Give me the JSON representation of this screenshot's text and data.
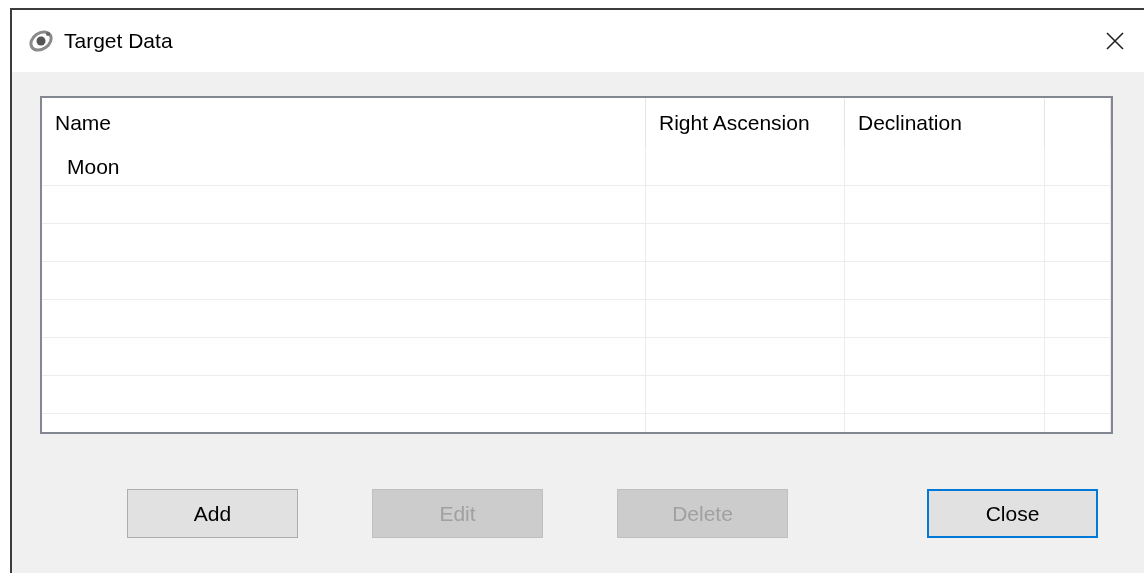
{
  "window": {
    "title": "Target Data"
  },
  "table": {
    "columns": [
      "Name",
      "Right Ascension",
      "Declination"
    ],
    "rows": [
      [
        "Moon",
        "",
        ""
      ]
    ]
  },
  "buttons": [
    {
      "label": "Add",
      "disabled": false,
      "focused": false
    },
    {
      "label": "Edit",
      "disabled": true,
      "focused": false
    },
    {
      "label": "Delete",
      "disabled": true,
      "focused": false
    },
    {
      "label": "Close",
      "disabled": false,
      "focused": true
    }
  ]
}
